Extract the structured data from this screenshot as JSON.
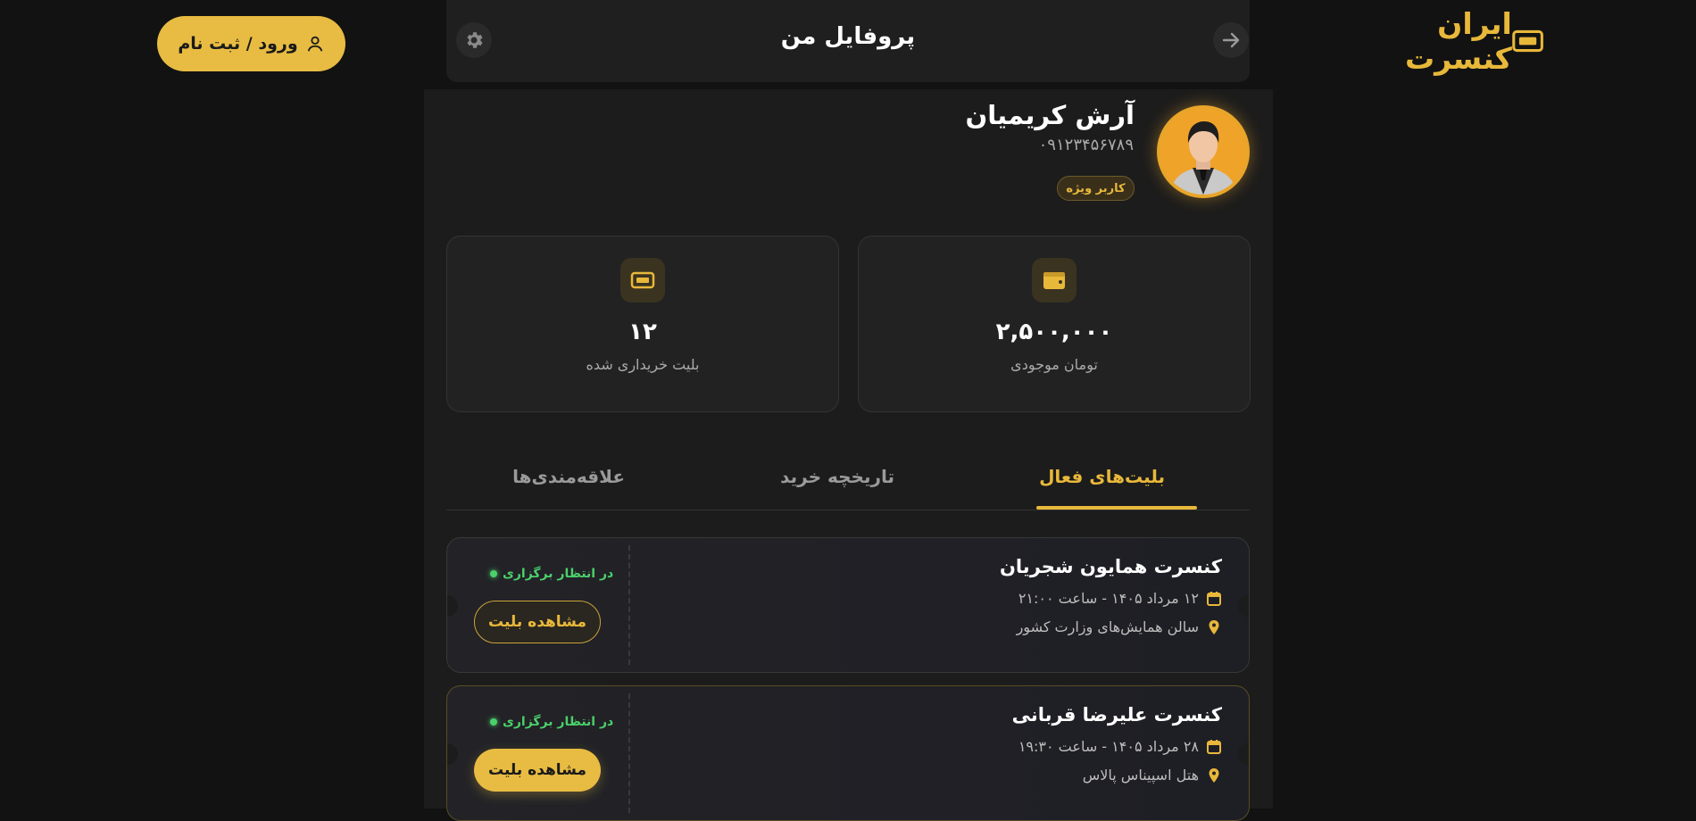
{
  "brand": {
    "name": "ایران کنسرت",
    "icon": "ticket-icon"
  },
  "auth": {
    "login_label": "ورود / ثبت نام",
    "icon": "user-icon"
  },
  "header": {
    "title": "پروفایل من",
    "back_icon": "arrow-right-icon",
    "settings_icon": "gear-icon"
  },
  "profile": {
    "name": "آرش کریمیان",
    "phone": "۰۹۱۲۳۴۵۶۷۸۹",
    "badge": "کاربر ویژه",
    "avatar_icon": "user-avatar"
  },
  "stats": [
    {
      "value": "۲,۵۰۰,۰۰۰",
      "label": "تومان موجودی",
      "icon": "wallet-icon"
    },
    {
      "value": "۱۲",
      "label": "بلیت خریداری شده",
      "icon": "ticket-icon"
    }
  ],
  "tabs": [
    {
      "label": "بلیت‌های فعال",
      "active": true
    },
    {
      "label": "تاریخچه خرید",
      "active": false
    },
    {
      "label": "علاقه‌مندی‌ها",
      "active": false
    }
  ],
  "tickets": [
    {
      "title": "کنسرت همایون شجریان",
      "date": "۱۲ مرداد ۱۴۰۵ - ساعت ۲۱:۰۰",
      "venue": "سالن همایش‌های وزارت کشور",
      "status": "در انتظار برگزاری",
      "button": "مشاهده بلیت"
    },
    {
      "title": "کنسرت علیرضا قربانی",
      "date": "۲۸ مرداد ۱۴۰۵ - ساعت ۱۹:۳۰",
      "venue": "هتل اسپیناس پالاس",
      "status": "در انتظار برگزاری",
      "button": "مشاهده بلیت"
    }
  ],
  "colors": {
    "accent": "#e8b83a",
    "background": "#121212",
    "panel": "#1c1c1c",
    "status_green": "#4bd06a"
  }
}
